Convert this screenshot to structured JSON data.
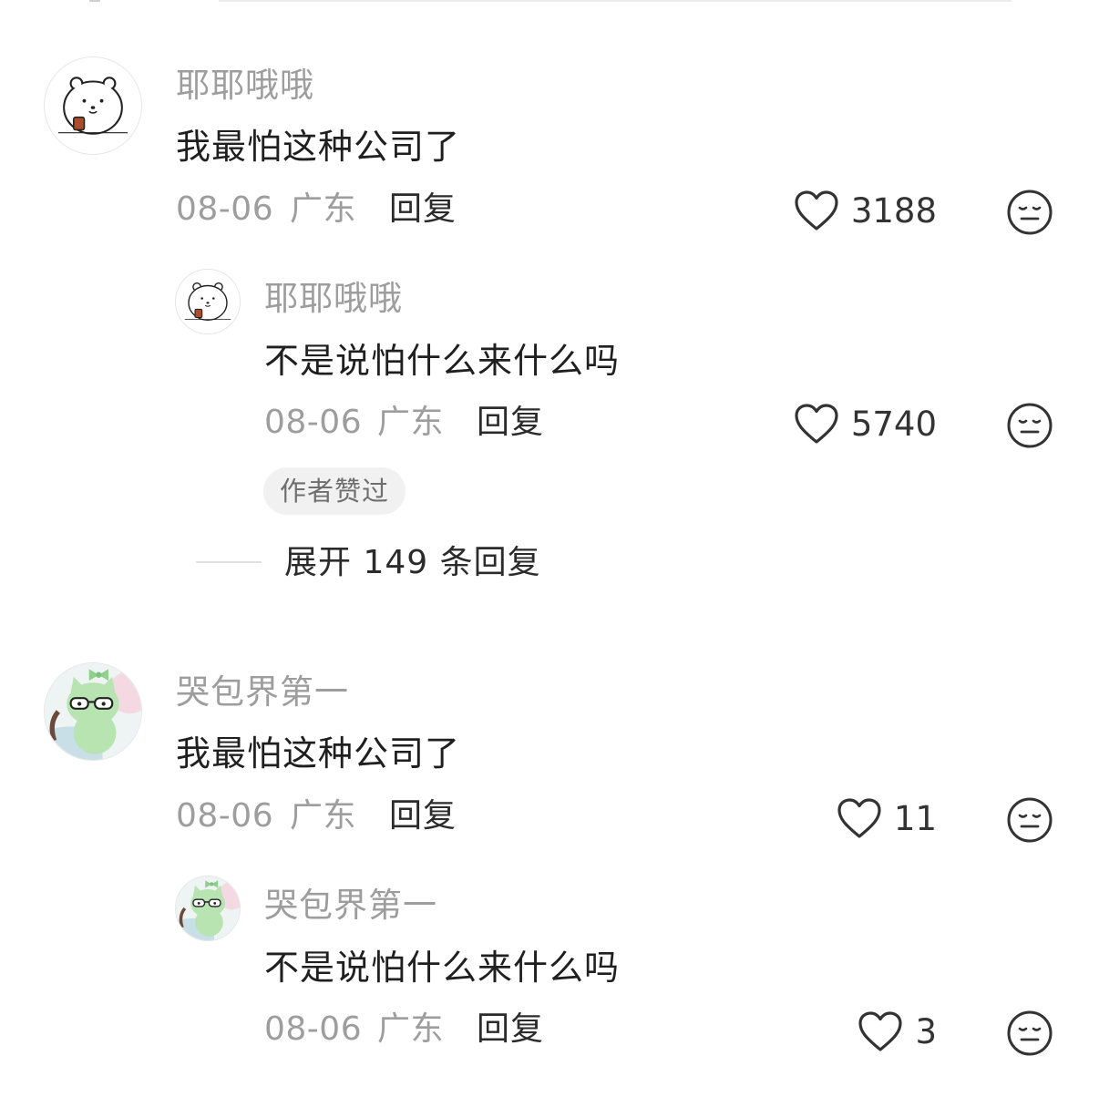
{
  "comments": [
    {
      "username": "耶耶哦哦",
      "text": "我最怕这种公司了",
      "date": "08-06",
      "location": "广东",
      "reply_label": "回复",
      "likes": "3188",
      "avatar": "polar-bear-with-cup-avatar",
      "replies": [
        {
          "username": "耶耶哦哦",
          "text": "不是说怕什么来什么吗",
          "date": "08-06",
          "location": "广东",
          "reply_label": "回复",
          "likes": "5740",
          "badge": "作者赞过",
          "avatar": "polar-bear-with-cup-avatar"
        }
      ],
      "expand_label": "展开 149 条回复"
    },
    {
      "username": "哭包界第一",
      "text": "我最怕这种公司了",
      "date": "08-06",
      "location": "广东",
      "reply_label": "回复",
      "likes": "11",
      "avatar": "green-cat-with-glasses-avatar",
      "replies": [
        {
          "username": "哭包界第一",
          "text": "不是说怕什么来什么吗",
          "date": "08-06",
          "location": "广东",
          "reply_label": "回复",
          "likes": "3",
          "avatar": "green-cat-with-glasses-avatar"
        }
      ]
    }
  ],
  "icons": {
    "like": "heart-outline-icon",
    "dislike": "meh-face-icon"
  },
  "colors": {
    "username": "#9d9d9d",
    "text": "#1f1f1f",
    "meta": "#9d9d9d",
    "badge_bg": "#f1f1f1",
    "avatar_cat_green": "#b7e4b0"
  }
}
